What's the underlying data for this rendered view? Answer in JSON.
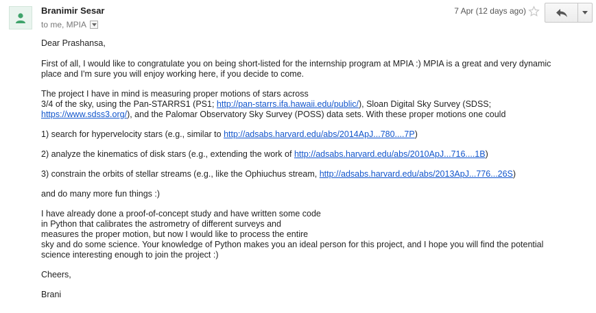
{
  "header": {
    "sender_name": "Branimir Sesar",
    "recipients": "to me, MPIA",
    "date": "7 Apr (12 days ago)",
    "avatar_icon": "person-icon",
    "star_icon": "star-outline-icon",
    "reply_icon": "reply-arrow-icon",
    "more_icon": "caret-down-icon",
    "colors": {
      "avatar_bg": "#e9f4ee",
      "avatar_fg": "#3fa36b",
      "link": "#1155cc"
    }
  },
  "body": {
    "greeting": "Dear Prashansa,",
    "p1": [
      "First of all, I would like to congratulate you on being short-listed for the internship program at MPIA :) MPIA is a great and very dynamic",
      "place and I'm sure you will enjoy working here, if you decide to come."
    ],
    "p2": {
      "l1": "The project I have in mind is measuring proper motions of stars across",
      "l2a": "3/4 of the sky, using the Pan-STARRS1 (PS1; ",
      "link1": "http://pan-starrs.ifa.hawaii.edu/public/",
      "l2b": "), Sloan Digital Sky Survey (SDSS;",
      "link2": "https://www.sdss3.org/",
      "l3b": "), and the Palomar Observatory Sky Survey (POSS) data sets. With these proper motions one could"
    },
    "item1": {
      "text": "1) search for hypervelocity stars (e.g., similar to ",
      "link": "http://adsabs.harvard.edu/abs/2014ApJ...780....7P",
      "end": ")"
    },
    "item2": {
      "text": "2) analyze the kinematics of disk stars (e.g., extending the work of ",
      "link": "http://adsabs.harvard.edu/abs/2010ApJ...716....1B",
      "end": ")"
    },
    "item3": {
      "text": "3) constrain the orbits of stellar streams (e.g., like the Ophiuchus stream, ",
      "link": "http://adsabs.harvard.edu/abs/2013ApJ...776...26S",
      "end": ")"
    },
    "more_fun": "and do many more fun things :)",
    "p3": [
      "I have already done a proof-of-concept study and have written some code",
      "in Python that calibrates the astrometry of different surveys and",
      "measures the proper motion, but now I would like to process the entire",
      "sky and do some science. Your knowledge of Python makes you an ideal person for this project, and I hope you will find the potential",
      "science interesting enough to join the project :)"
    ],
    "closing": "Cheers,",
    "signature": "Brani"
  }
}
